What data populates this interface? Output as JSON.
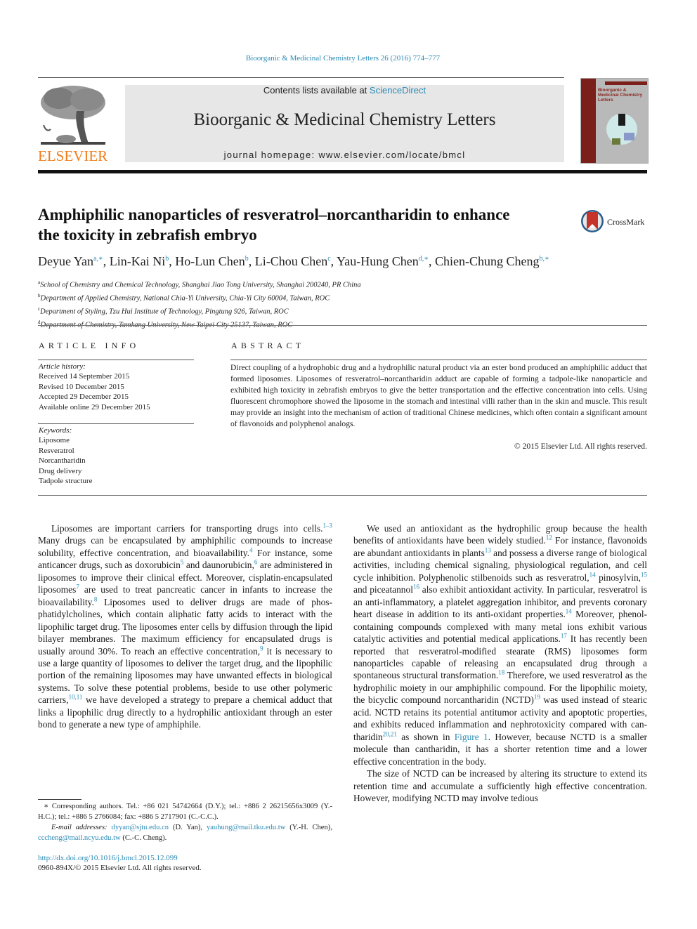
{
  "header": {
    "citation": "Bioorganic & Medicinal Chemistry Letters 26 (2016) 774–777",
    "contents_prefix": "Contents lists available at ",
    "contents_link": "ScienceDirect",
    "journal_name": "Bioorganic & Medicinal Chemistry Letters",
    "homepage_prefix": "journal homepage: ",
    "homepage_url": "www.elsevier.com/locate/bmcl",
    "publisher_wordmark": "ELSEVIER",
    "cover_title": "Bioorganic & Medicinal Chemistry Letters",
    "colors": {
      "link": "#2a8ab5",
      "elsevier_orange": "#f07d1a",
      "cover_red": "#7b1f1a",
      "banner_gray": "#e7e7e7"
    }
  },
  "article": {
    "title_line1": "Amphiphilic nanoparticles of resveratrol–norcantharidin to enhance",
    "title_line2": "the toxicity in zebrafish embryo",
    "crossmark_label": "CrossMark",
    "authors": [
      {
        "name": "Deyue Yan",
        "sup": "a,∗"
      },
      {
        "name": "Lin-Kai Ni",
        "sup": "b"
      },
      {
        "name": "Ho-Lun Chen",
        "sup": "b"
      },
      {
        "name": "Li-Chou Chen",
        "sup": "c"
      },
      {
        "name": "Yau-Hung Chen",
        "sup": "d,∗"
      },
      {
        "name": "Chien-Chung Cheng",
        "sup": "b,∗"
      }
    ],
    "affiliations": [
      {
        "mark": "a",
        "text": "School of Chemistry and Chemical Technology, Shanghai Jiao Tong University, Shanghai 200240, PR China"
      },
      {
        "mark": "b",
        "text": "Department of Applied Chemistry, National Chia-Yi University, Chia-Yi City 60004, Taiwan, ROC"
      },
      {
        "mark": "c",
        "text": "Department of Styling, Tzu Hui Institute of Technology, Pingtung 926, Taiwan, ROC"
      },
      {
        "mark": "d",
        "text": "Department of Chemistry, Tamkang University, New Taipei City 25137, Taiwan, ROC"
      }
    ]
  },
  "article_info": {
    "heading": "ARTICLE INFO",
    "history_label": "Article history:",
    "history": [
      "Received 14 September 2015",
      "Revised 10 December 2015",
      "Accepted 29 December 2015",
      "Available online 29 December 2015"
    ],
    "keywords_label": "Keywords:",
    "keywords": [
      "Liposome",
      "Resveratrol",
      "Norcantharidin",
      "Drug delivery",
      "Tadpole structure"
    ]
  },
  "abstract": {
    "heading": "ABSTRACT",
    "text": "Direct coupling of a hydrophobic drug and a hydrophilic natural product via an ester bond produced an amphiphilic adduct that formed liposomes. Liposomes of resveratrol–norcantharidin adduct are capable of forming a tadpole-like nanoparticle and exhibited high toxicity in zebrafish embryos to give the better transportation and the effective concentration into cells. Using fluorescent chromophore showed the liposome in the stomach and intestinal villi rather than in the skin and muscle. This result may provide an insight into the mechanism of action of traditional Chinese medicines, which often contain a signifi­cant amount of flavonoids and polyphenol analogs.",
    "copyright": "© 2015 Elsevier Ltd. All rights reserved."
  },
  "body": {
    "left": [
      {
        "t": "Liposomes are important carriers for transporting drugs into cells."
      },
      {
        "ref": "1–3"
      },
      {
        "t": " Many drugs can be encapsulated by amphiphilic com­pounds to increase solubility, effective concentration, and bioavail­ability."
      },
      {
        "ref": "4"
      },
      {
        "t": " For instance, some anticancer drugs, such as doxorubicin"
      },
      {
        "ref": "5"
      },
      {
        "t": " and daunorubicin,"
      },
      {
        "ref": "6"
      },
      {
        "t": " are administered in liposomes to improve their clinical effect. Moreover, cisplatin-encapsulated liposomes"
      },
      {
        "ref": "7"
      },
      {
        "t": " are used to treat pancreatic cancer in infants to increase the bioavail­ability."
      },
      {
        "ref": "8"
      },
      {
        "t": " Liposomes used to deliver drugs are made of phos­phatidylcholines, which contain aliphatic fatty acids to interact with the lipophilic target drug. The liposomes enter cells by diffu­sion through the lipid bilayer membranes. The maximum effi­ciency for encapsulated drugs is usually around 30%. To reach an effective concentration,"
      },
      {
        "ref": "9"
      },
      {
        "t": " it is necessary to use a large quantity of liposomes to deliver the target drug, and the lipophilic portion of the remaining liposomes may have unwanted effects in biological systems. To solve these potential problems, beside to use other polymeric carriers,"
      },
      {
        "ref": "10,11"
      },
      {
        "t": " we have developed a strategy to prepare a chemical adduct that links a lipophilic drug directly to a hydro­philic antioxidant through an ester bond to generate a new type of amphiphile."
      }
    ],
    "right_p1": [
      {
        "t": "We used an antioxidant as the hydrophilic group because the health benefits of antioxidants have been widely studied."
      },
      {
        "ref": "12"
      },
      {
        "t": " For instance, flavonoids are abundant antioxidants in plants"
      },
      {
        "ref": "13"
      },
      {
        "t": " and pos­sess a diverse range of biological activities, including chemical sig­naling, physiological regulation, and cell cycle inhibition. Polyphenolic stilbenoids such as resveratrol,"
      },
      {
        "ref": "14"
      },
      {
        "t": " pinosylvin,"
      },
      {
        "ref": "15"
      },
      {
        "t": " and piceatannol"
      },
      {
        "ref": "16"
      },
      {
        "t": " also exhibit antioxidant activity. In particular, resveratrol is an anti-inflammatory, a platelet aggregation inhibi­tor, and prevents coronary heart disease in addition to its anti-oxi­dant properties."
      },
      {
        "ref": "14"
      },
      {
        "t": " Moreover, phenol-containing compounds complexed with many metal ions exhibit various catalytic activi­ties and potential medical applications."
      },
      {
        "ref": "17"
      },
      {
        "t": " It has recently been reported that resveratrol-modified stearate (RMS) liposomes form nanoparticles capable of releasing an encapsulated drug through a spontaneous structural transformation."
      },
      {
        "ref": "18"
      },
      {
        "t": " Therefore, we used resveratrol as the hydrophilic moiety in our amphiphilic com­pound. For the lipophilic moiety, the bicyclic compound norcan­tharidin (NCTD)"
      },
      {
        "ref": "19"
      },
      {
        "t": " was used instead of stearic acid. NCTD retains its potential antitumor activity and apoptotic properties, and exhi­bits reduced inflammation and nephrotoxicity compared with can­tharidin"
      },
      {
        "ref": "20,21"
      },
      {
        "t": " as shown in "
      },
      {
        "link": "Figure 1"
      },
      {
        "t": ". However, because NCTD is a smaller molecule than cantharidin, it has a shorter retention time and a lower effective concentration in the body."
      }
    ],
    "right_p2": "The size of NCTD can be increased by altering its structure to extend its retention time and accumulate a sufficiently high effec­tive concentration. However, modifying NCTD may involve tedious"
  },
  "footnotes": {
    "corresponding": "∗ Corresponding authors. Tel.: +86 021 54742664 (D.Y.); tel.: +886 2 26215656x3009 (Y.-H.C.); tel.: +886 5 2766084; fax: +886 5 2717901 (C.-C.C.).",
    "email_label": "E-mail addresses:",
    "emails": [
      {
        "addr": "dyyan@sjtu.edu.cn",
        "who": " (D. Yan), "
      },
      {
        "addr": "yauhung@mail.tku.edu.tw",
        "who": " (Y.-H. Chen), "
      },
      {
        "addr": "cccheng@mail.ncyu.edu.tw",
        "who": " (C.-C. Cheng)."
      }
    ],
    "doi": "http://dx.doi.org/10.1016/j.bmcl.2015.12.099",
    "issn": "0960-894X/© 2015 Elsevier Ltd. All rights reserved."
  }
}
